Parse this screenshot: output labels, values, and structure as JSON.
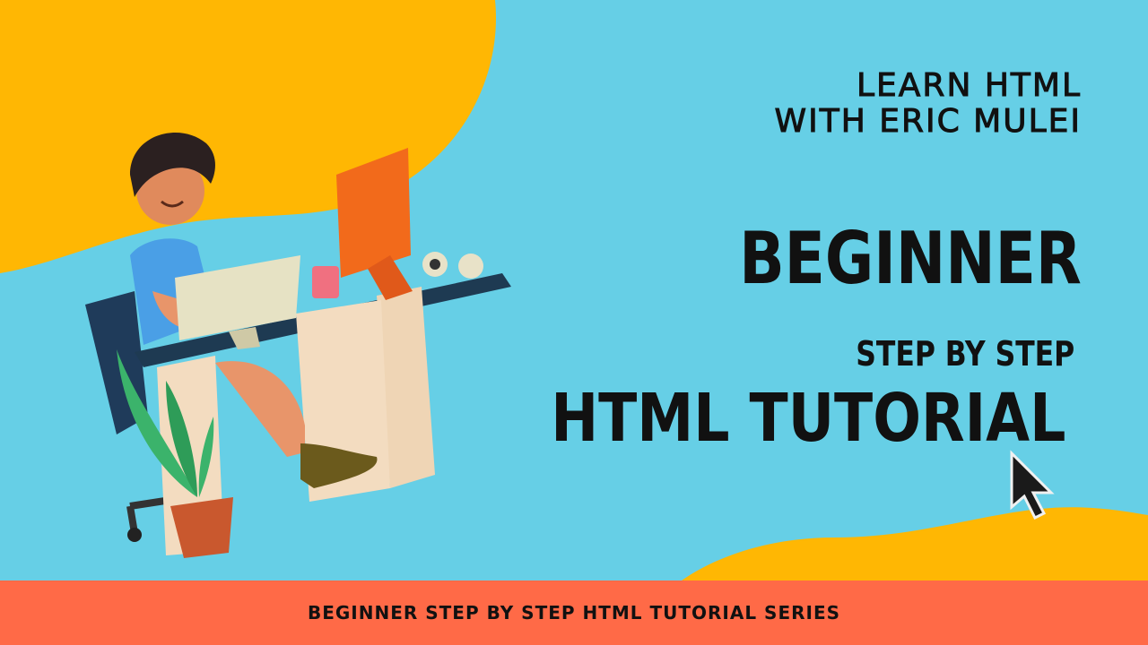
{
  "title": {
    "learn_line1": "LEARN  HTML",
    "learn_line2": "WITH  ERIC MULEI",
    "beginner": "BEGINNER",
    "step_by_step": "STEP BY STEP",
    "html_tutorial": "HTML TUTORIAL"
  },
  "footer": {
    "text": "BEGINNER STEP BY STEP HTML TUTORIAL SERIES"
  },
  "colors": {
    "background": "#66cfe6",
    "blob": "#ffb703",
    "footer": "#ff6a47",
    "text": "#111111"
  },
  "icons": {
    "cursor": "mouse-pointer-icon",
    "illustration": "developer-at-desk-illustration"
  }
}
